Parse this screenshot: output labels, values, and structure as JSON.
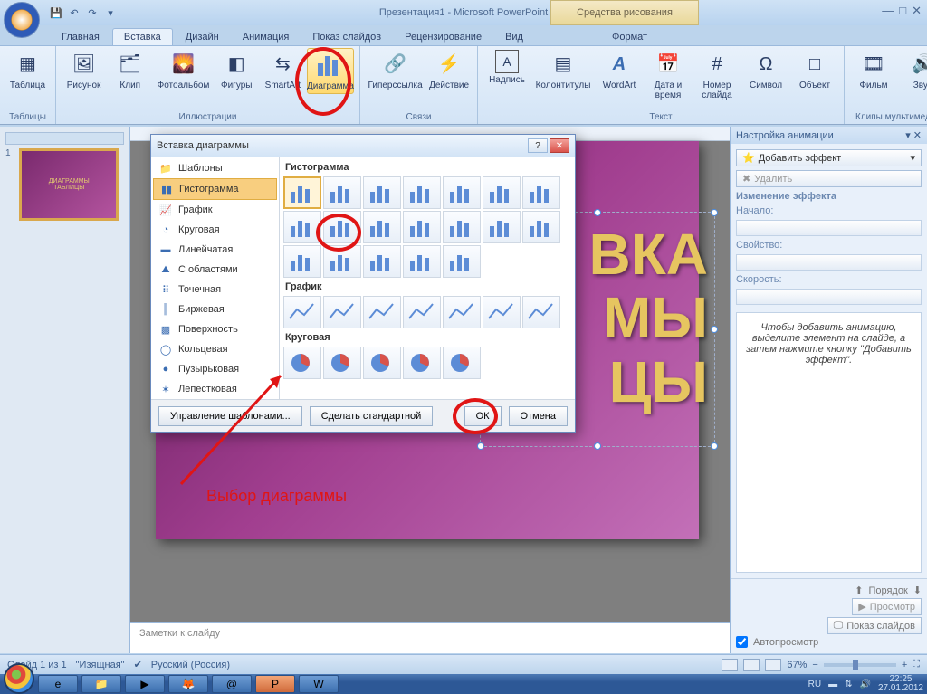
{
  "title": "Презентация1 - Microsoft PowerPoint",
  "contextual_tab": "Средства рисования",
  "tabs": [
    "Главная",
    "Вставка",
    "Дизайн",
    "Анимация",
    "Показ слайдов",
    "Рецензирование",
    "Вид",
    "Формат"
  ],
  "active_tab_index": 1,
  "ribbon": {
    "groups": {
      "tables": {
        "label": "Таблицы",
        "items": {
          "table": "Таблица"
        }
      },
      "illustrations": {
        "label": "Иллюстрации",
        "items": {
          "picture": "Рисунок",
          "clip": "Клип",
          "album": "Фотоальбом",
          "shapes": "Фигуры",
          "smartart": "SmartArt",
          "chart": "Диаграмма"
        }
      },
      "links": {
        "label": "Связи",
        "items": {
          "hyperlink": "Гиперссылка",
          "action": "Действие"
        }
      },
      "text": {
        "label": "Текст",
        "items": {
          "textbox": "Надпись",
          "headerfooter": "Колонтитулы",
          "wordart": "WordArt",
          "datetime": "Дата и\nвремя",
          "slidenum": "Номер\nслайда",
          "symbol": "Символ",
          "object": "Объект"
        }
      },
      "media": {
        "label": "Клипы мультимедиа",
        "items": {
          "movie": "Фильм",
          "sound": "Звук"
        }
      }
    }
  },
  "dialog": {
    "title": "Вставка диаграммы",
    "categories": [
      "Шаблоны",
      "Гистограмма",
      "График",
      "Круговая",
      "Линейчатая",
      "С областями",
      "Точечная",
      "Биржевая",
      "Поверхность",
      "Кольцевая",
      "Пузырьковая",
      "Лепестковая"
    ],
    "selected_category_index": 1,
    "sections": [
      "Гистограмма",
      "График",
      "Круговая"
    ],
    "manage_templates": "Управление шаблонами...",
    "set_default": "Сделать стандартной",
    "ok": "ОК",
    "cancel": "Отмена"
  },
  "annotation": {
    "label": "Выбор диаграммы"
  },
  "anim": {
    "title": "Настройка анимации",
    "add_effect": "Добавить эффект",
    "remove": "Удалить",
    "modify": "Изменение эффекта",
    "start": "Начало:",
    "property": "Свойство:",
    "speed": "Скорость:",
    "help": "Чтобы добавить анимацию, выделите элемент на слайде, а затем нажмите кнопку \"Добавить эффект\".",
    "reorder": "Порядок",
    "preview": "Просмотр",
    "slideshow": "Показ слайдов",
    "autopreview": "Автопросмотр"
  },
  "slide_text": [
    "ВКА",
    "МЫ",
    "ЦЫ"
  ],
  "thumb_text": "ДИАГРАММЫ\nТАБЛИЦЫ",
  "notes_placeholder": "Заметки к слайду",
  "status": {
    "slide": "Слайд 1 из 1",
    "theme": "\"Изящная\"",
    "lang": "Русский (Россия)",
    "zoom": "67%"
  },
  "tray": {
    "lang": "RU",
    "time": "22:25",
    "date": "27.01.2012"
  }
}
